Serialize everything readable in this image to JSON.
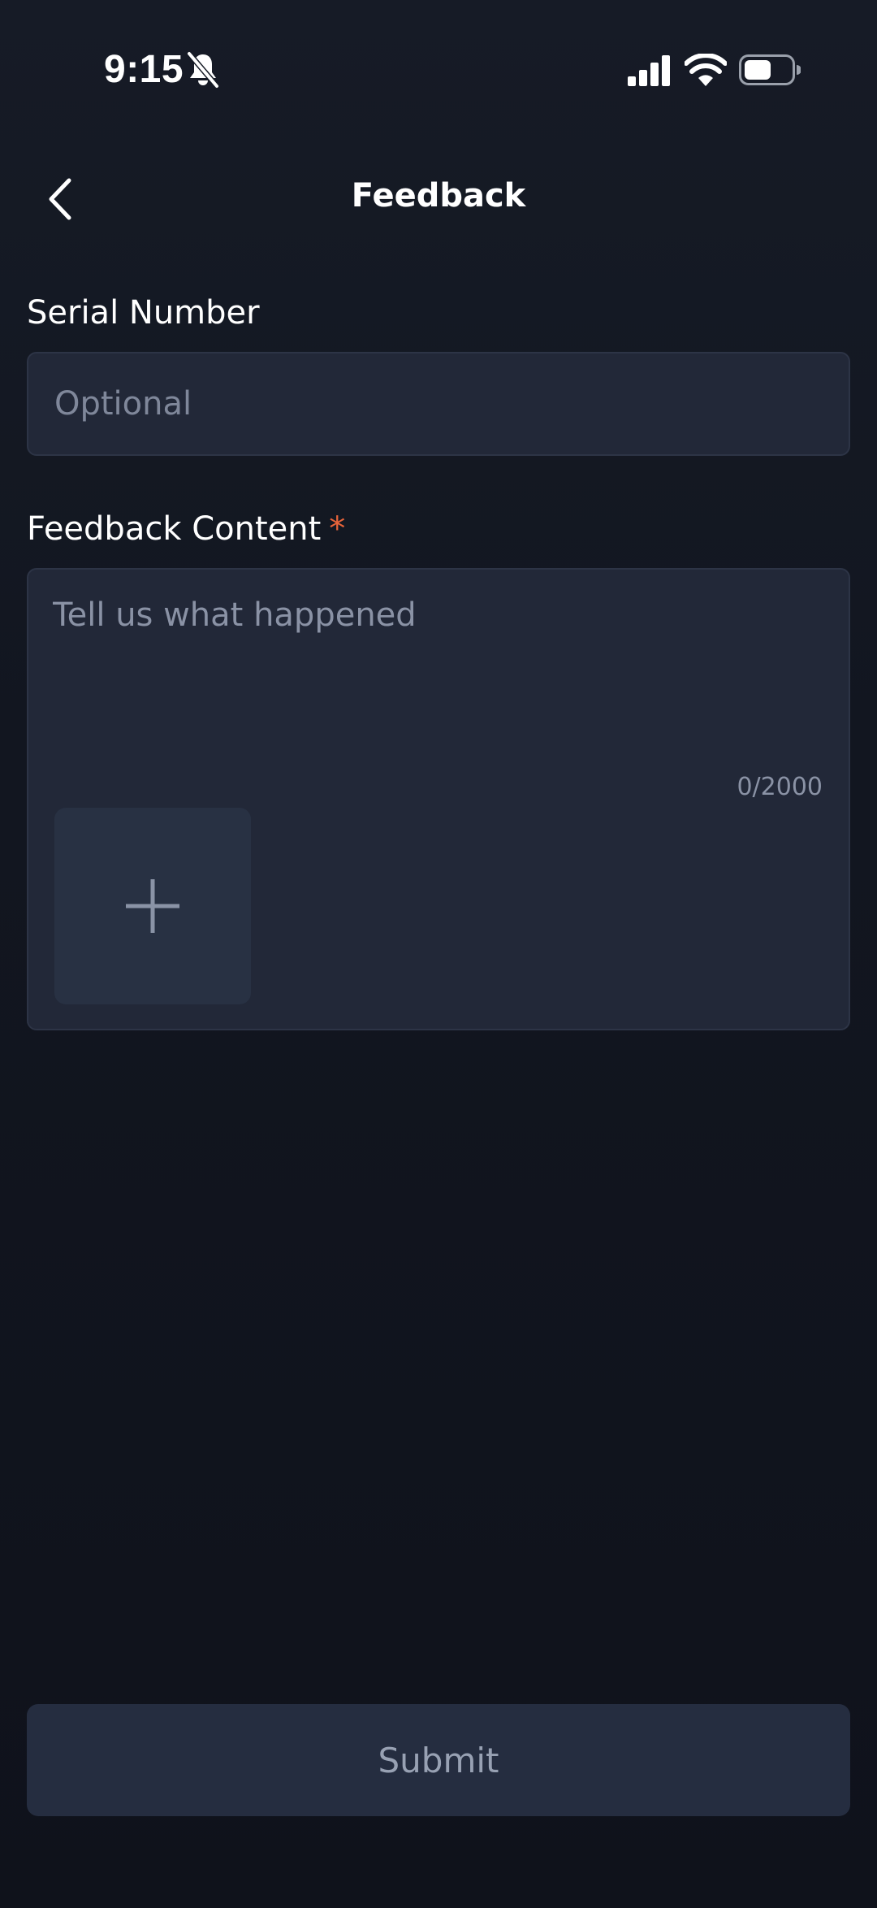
{
  "status_bar": {
    "time": "9:15"
  },
  "header": {
    "title": "Feedback"
  },
  "serial": {
    "label": "Serial Number",
    "placeholder": "Optional",
    "value": ""
  },
  "feedback": {
    "label": "Feedback Content",
    "required_mark": "*",
    "placeholder": "Tell us what happened",
    "value": "",
    "counter": "0/2000"
  },
  "submit": {
    "label": "Submit"
  },
  "icons": {
    "back": "chevron-left-icon",
    "add": "plus-icon",
    "bell": "bell-slash-icon",
    "signal": "cellular-signal-icon",
    "wifi": "wifi-icon",
    "battery": "battery-icon"
  },
  "colors": {
    "background": "#121620",
    "field_background": "#222838",
    "required": "#e8643a",
    "submit_background": "#252d40",
    "submit_text": "#98a1b3"
  }
}
